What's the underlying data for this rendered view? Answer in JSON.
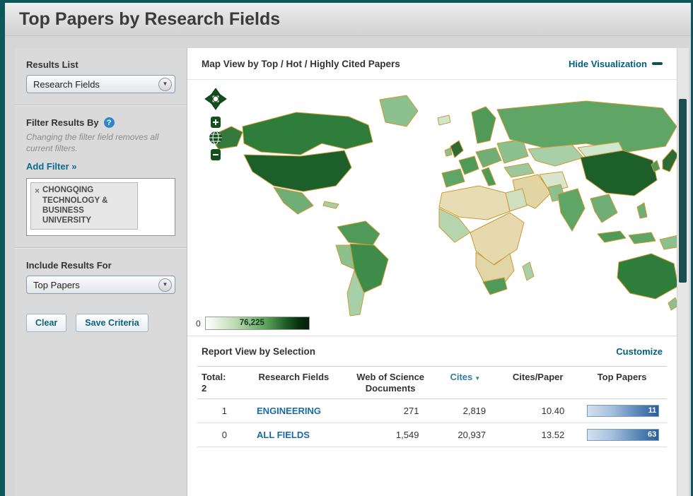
{
  "page": {
    "title": "Top Papers by Research Fields"
  },
  "sidebar": {
    "results_list": {
      "label": "Results List",
      "selected": "Research Fields"
    },
    "filter": {
      "label": "Filter Results By",
      "note": "Changing the filter field removes all current filters.",
      "add_filter_label": "Add Filter »",
      "tags": [
        {
          "label": "CHONGQING TECHNOLOGY & BUSINESS UNIVERSITY"
        }
      ]
    },
    "include_results": {
      "label": "Include Results For",
      "selected": "Top Papers"
    },
    "buttons": {
      "clear": "Clear",
      "save": "Save Criteria"
    }
  },
  "map_section": {
    "title": "Map View by Top / Hot / Highly Cited Papers",
    "hide_link": "Hide Visualization",
    "legend": {
      "min": "0",
      "max": "76,225"
    }
  },
  "report": {
    "title": "Report View by Selection",
    "customize_link": "Customize",
    "total_label": "Total:",
    "total_value": "2",
    "columns": [
      "Research Fields",
      "Web of Science Documents",
      "Cites",
      "Cites/Paper",
      "Top Papers"
    ],
    "rows": [
      {
        "rank": "1",
        "field": "ENGINEERING",
        "wos_documents": "271",
        "cites": "2,819",
        "cites_per_paper": "10.40",
        "top_papers": "11"
      },
      {
        "rank": "0",
        "field": "ALL FIELDS",
        "wos_documents": "1,549",
        "cites": "20,937",
        "cites_per_paper": "13.52",
        "top_papers": "63"
      }
    ]
  },
  "icons": {
    "help": "?",
    "remove": "×",
    "chevron": "▼",
    "sort": "▼"
  },
  "colors": {
    "frame_teal": "#0e5659",
    "link_teal": "#00607f",
    "link_blue": "#1a6aa8",
    "bar_blue_dark": "#2c5e96",
    "map_green_dark": "#1d5f2a",
    "map_outline": "#cc9933"
  }
}
